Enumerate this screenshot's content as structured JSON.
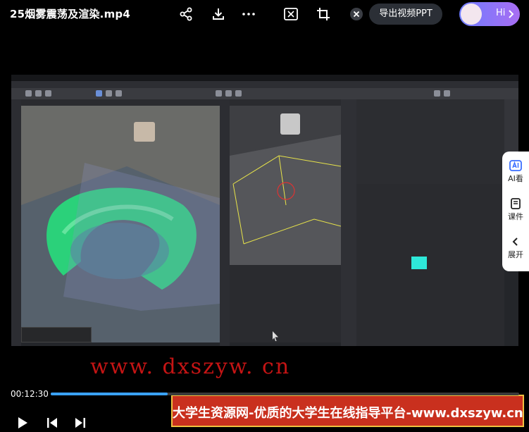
{
  "top_bar": {
    "title": "25烟雾震荡及渲染.mp4",
    "export_label": "导出视频PPT",
    "hi_label": "Hi",
    "icons": [
      "share-icon",
      "download-icon",
      "more-icon",
      "screenshot-icon",
      "crop-icon",
      "close-icon",
      "chevron-right-icon"
    ]
  },
  "side_panel": {
    "items": [
      {
        "label": "AI看",
        "icon": "ai-icon"
      },
      {
        "label": "课件",
        "icon": "courseware-icon"
      },
      {
        "label": "展开",
        "icon": "chevron-left-icon"
      }
    ]
  },
  "watermark": {
    "url": "www. dxszyw. cn",
    "banner": "大学生资源网-优质的大学生在线指导平台-www.dxszyw.cn"
  },
  "player": {
    "current_time": "00:12:30",
    "progress": 0.25,
    "icons": [
      "play-icon",
      "previous-icon",
      "next-icon"
    ]
  },
  "colors": {
    "accent": "#3aa2ff",
    "smoke": "#2bd17a",
    "swatch": "#2ee8d9",
    "banner": "#c9301e"
  }
}
